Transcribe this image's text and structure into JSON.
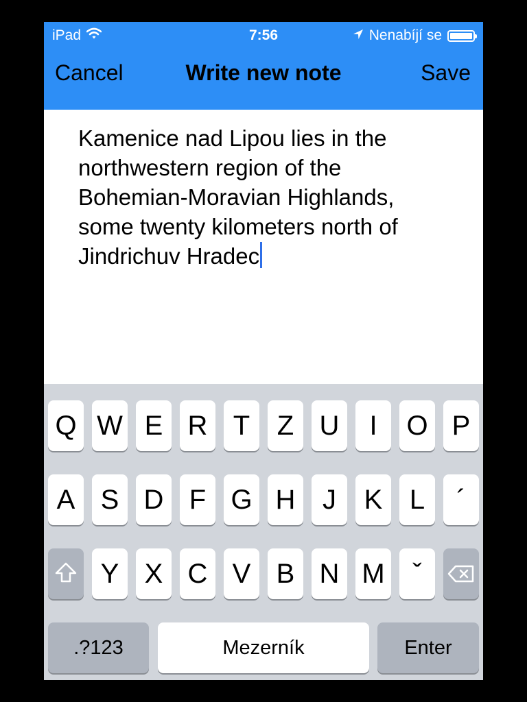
{
  "status_bar": {
    "device": "iPad",
    "time": "7:56",
    "battery_text": "Nenabíjí se"
  },
  "nav": {
    "cancel_label": "Cancel",
    "title": "Write new note",
    "save_label": "Save"
  },
  "note": {
    "text": "Kamenice nad Lipou lies in the northwestern region of the Bohemian-Moravian Highlands, some twenty kilometers north of Jindrichuv Hradec"
  },
  "keyboard": {
    "row1": [
      "Q",
      "W",
      "E",
      "R",
      "T",
      "Z",
      "U",
      "I",
      "O",
      "P"
    ],
    "row2": [
      "A",
      "S",
      "D",
      "F",
      "G",
      "H",
      "J",
      "K",
      "L",
      "´"
    ],
    "row3": [
      "Y",
      "X",
      "C",
      "V",
      "B",
      "N",
      "M",
      "ˇ"
    ],
    "numbers_label": ".?123",
    "space_label": "Mezerník",
    "enter_label": "Enter"
  },
  "colors": {
    "accent": "#2d8ef6",
    "keyboard_bg": "#d1d5db",
    "caret": "#2f6fe8"
  }
}
